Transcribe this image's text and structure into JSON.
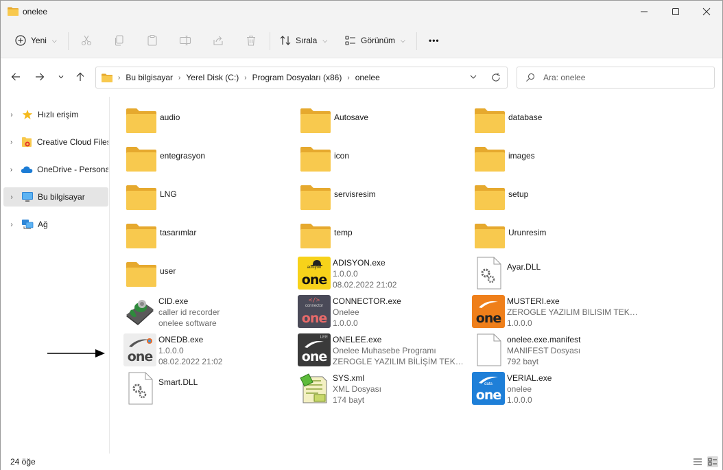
{
  "window": {
    "title": "onelee"
  },
  "toolbar": {
    "new_label": "Yeni",
    "sort_label": "Sırala",
    "view_label": "Görünüm",
    "more_label": "•••"
  },
  "address": {
    "crumbs": [
      "Bu bilgisayar",
      "Yerel Disk (C:)",
      "Program Dosyaları (x86)",
      "onelee"
    ]
  },
  "search": {
    "placeholder": "Ara: onelee"
  },
  "sidebar": {
    "items": [
      {
        "label": "Hızlı erişim",
        "icon": "star-icon"
      },
      {
        "label": "Creative Cloud Files",
        "icon": "creative-cloud-icon"
      },
      {
        "label": "OneDrive - Personal",
        "icon": "cloud-icon"
      },
      {
        "label": "Bu bilgisayar",
        "icon": "computer-icon"
      },
      {
        "label": "Ağ",
        "icon": "network-icon"
      }
    ]
  },
  "files": [
    {
      "name": "audio",
      "type": "folder"
    },
    {
      "name": "Autosave",
      "type": "folder"
    },
    {
      "name": "database",
      "type": "folder"
    },
    {
      "name": "entegrasyon",
      "type": "folder"
    },
    {
      "name": "icon",
      "type": "folder"
    },
    {
      "name": "images",
      "type": "folder"
    },
    {
      "name": "LNG",
      "type": "folder"
    },
    {
      "name": "servisresim",
      "type": "folder"
    },
    {
      "name": "setup",
      "type": "folder"
    },
    {
      "name": "tasarımlar",
      "type": "folder"
    },
    {
      "name": "temp",
      "type": "folder"
    },
    {
      "name": "Urunresim",
      "type": "folder"
    },
    {
      "name": "user",
      "type": "folder"
    },
    {
      "name": "ADISYON.exe",
      "line2": "1.0.0.0",
      "line3": "08.02.2022 21:02",
      "icon_top": "adisyon",
      "icon_main": "one"
    },
    {
      "name": "Ayar.DLL",
      "type": "dll"
    },
    {
      "name": "CID.exe",
      "line2": "caller id recorder",
      "line3": "onelee software",
      "type": "phone"
    },
    {
      "name": "CONNECTOR.exe",
      "line2": "Onelee",
      "line3": "1.0.0.0",
      "icon_top": "connector",
      "icon_main": "one"
    },
    {
      "name": "MUSTERI.exe",
      "line2": "ZEROGLE YAZILIM BILISIM TEKNO...",
      "line3": "1.0.0.0",
      "icon_main": "one"
    },
    {
      "name": "ONEDB.exe",
      "line2": "1.0.0.0",
      "line3": "08.02.2022 21:02",
      "icon_main": "one"
    },
    {
      "name": "ONELEE.exe",
      "line2": "Onelee Muhasebe Programı",
      "line3": "ZEROGLE YAZILIM BİLİŞİM TEKNO...",
      "icon_top": "LEE",
      "icon_main": "one"
    },
    {
      "name": "onelee.exe.manifest",
      "line2": "MANIFEST Dosyası",
      "line3": "792 bayt",
      "type": "manifest"
    },
    {
      "name": "Smart.DLL",
      "type": "dll"
    },
    {
      "name": "SYS.xml",
      "line2": "XML Dosyası",
      "line3": "174 bayt",
      "type": "xml"
    },
    {
      "name": "VERIAL.exe",
      "line2": "onelee",
      "line3": "1.0.0.0",
      "icon_top": "data",
      "icon_main": "one"
    }
  ],
  "status": {
    "item_count": "24 öğe"
  },
  "colors": {
    "folder": "#F8C94E",
    "accent": "#0078D4"
  }
}
